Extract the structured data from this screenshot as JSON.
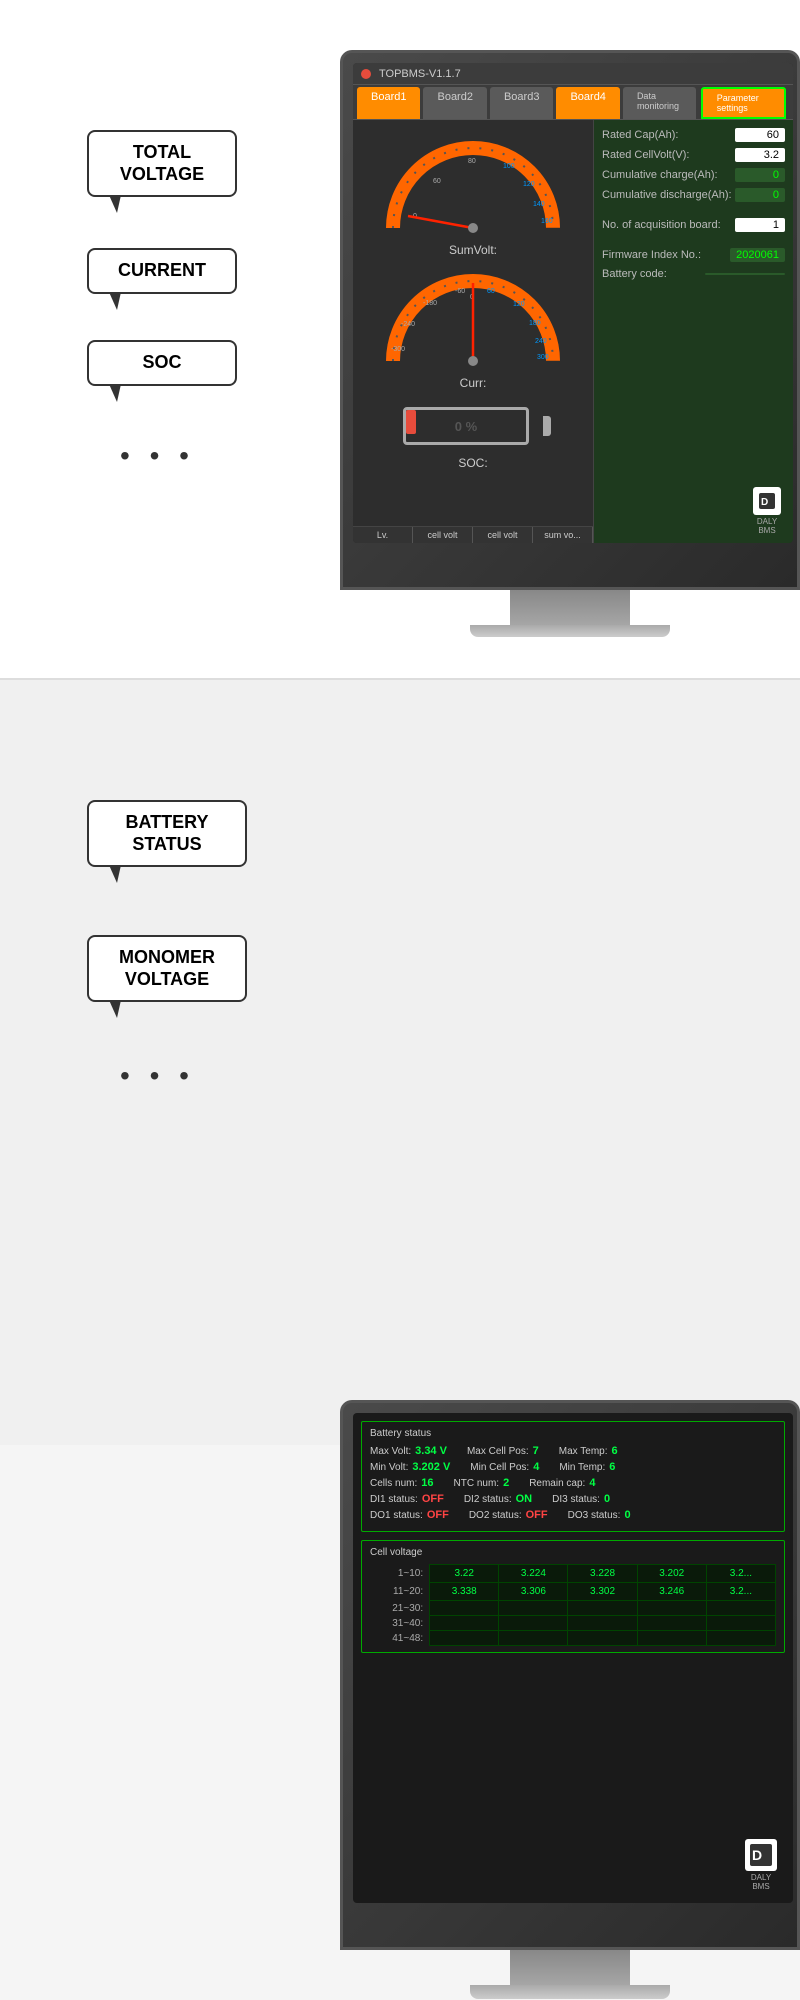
{
  "top_section": {
    "bubbles": {
      "voltage_label": "TOTAL\nVOLTAGE",
      "voltage_line1": "TOTAL",
      "voltage_line2": "VOLTAGE",
      "current_label": "CURRENT",
      "soc_label": "SOC",
      "dots": "• • •"
    },
    "app": {
      "title": "TOPBMS-V1.1.7",
      "tabs": [
        "Board1",
        "Board2",
        "Board3",
        "Board4"
      ],
      "sub_tabs": [
        "Data monitoring",
        "Parameter settings"
      ],
      "active_tab": "Board1",
      "gauges": {
        "voltage_label": "SumVolt:",
        "current_label": "Curr:"
      },
      "soc": {
        "label": "SOC:",
        "percent": "0 %"
      },
      "params": {
        "rated_cap_label": "Rated Cap(Ah):",
        "rated_cap_value": "60",
        "rated_cell_volt_label": "Rated CellVolt(V):",
        "rated_cell_volt_value": "3.2",
        "cumulative_charge_label": "Cumulative charge(Ah):",
        "cumulative_charge_value": "0",
        "cumulative_discharge_label": "Cumulative discharge(Ah):",
        "cumulative_discharge_value": "0",
        "acq_board_label": "No. of acquisition board:",
        "acq_board_value": "1",
        "firmware_label": "Firmware Index No.:",
        "firmware_value": "2020061",
        "battery_code_label": "Battery code:"
      },
      "bottom_tabs": [
        "Lv.",
        "cell volt",
        "cell volt",
        "sum vo..."
      ]
    }
  },
  "bottom_section": {
    "bubbles": {
      "battery_line1": "BATTERY",
      "battery_line2": "STATUS",
      "monomer_line1": "MONOMER",
      "monomer_line2": "VOLTAGE",
      "dots": "• • •"
    },
    "app": {
      "battery_status": {
        "section_title": "Battery status",
        "max_volt_label": "Max Volt:",
        "max_volt_value": "3.34 V",
        "max_cell_pos_label": "Max Cell Pos:",
        "max_cell_pos_value": "7",
        "max_temp_label": "Max Temp:",
        "max_temp_value": "6",
        "min_volt_label": "Min Volt:",
        "min_volt_value": "3.202 V",
        "min_cell_pos_label": "Min Cell Pos:",
        "min_cell_pos_value": "4",
        "min_temp_label": "Min Temp:",
        "min_temp_value": "6",
        "cells_num_label": "Cells num:",
        "cells_num_value": "16",
        "ntc_num_label": "NTC num:",
        "ntc_num_value": "2",
        "remain_cap_label": "Remain cap:",
        "remain_cap_value": "4",
        "di1_label": "DI1 status:",
        "di1_value": "OFF",
        "di2_label": "DI2 status:",
        "di2_value": "ON",
        "di3_label": "DI3 status:",
        "di3_value": "0",
        "do1_label": "DO1 status:",
        "do1_value": "OFF",
        "do2_label": "DO2 status:",
        "do2_value": "OFF",
        "do3_label": "DO3 status:",
        "do3_value": "0"
      },
      "cell_voltage": {
        "section_title": "Cell voltage",
        "rows": [
          {
            "label": "1~10:",
            "values": [
              "3.22",
              "3.224",
              "3.228",
              "3.202",
              "3.2..."
            ]
          },
          {
            "label": "11~20:",
            "values": [
              "3.338",
              "3.306",
              "3.302",
              "3.246",
              "3.2..."
            ]
          },
          {
            "label": "21~30:",
            "values": [
              "",
              "",
              "",
              "",
              ""
            ]
          },
          {
            "label": "31~40:",
            "values": [
              "",
              "",
              "",
              "",
              ""
            ]
          },
          {
            "label": "41~48:",
            "values": [
              "",
              "",
              "",
              "",
              ""
            ]
          }
        ]
      }
    }
  },
  "daly_bms": {
    "logo_text": "DALY\nBMS"
  }
}
